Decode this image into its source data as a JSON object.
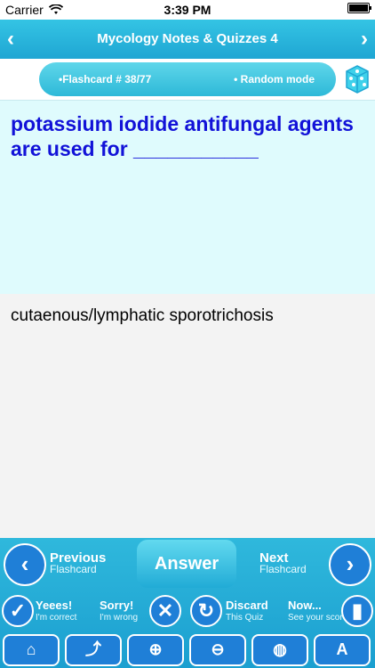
{
  "status": {
    "carrier": "Carrier",
    "time": "3:39 PM"
  },
  "header": {
    "title": "Mycology Notes & Quizzes 4",
    "prev_icon": "chevron-left-icon",
    "next_icon": "chevron-right-icon"
  },
  "info": {
    "flashcard_label": "•Flashcard #  38/77",
    "mode_label": "• Random mode",
    "dice_icon": "dice-icon"
  },
  "question": {
    "text": "potassium iodide antifungal agents are used for ___________"
  },
  "answer": {
    "text": "cutaenous/lymphatic sporotrichosis"
  },
  "controls": {
    "previous_big": "Previous",
    "previous_small": "Flashcard",
    "answer": "Answer",
    "next_big": "Next",
    "next_small": "Flashcard"
  },
  "feedback": [
    {
      "title": "Yeees!",
      "subtitle": "I'm correct",
      "icon": "check-icon"
    },
    {
      "title": "Sorry!",
      "subtitle": "I'm wrong",
      "icon": "x-icon"
    },
    {
      "title": "Discard",
      "subtitle": "This Quiz",
      "icon": "recycle-icon"
    },
    {
      "title": "Now...",
      "subtitle": "See your score",
      "icon": "chart-icon"
    }
  ],
  "tools": [
    {
      "icon": "home-icon"
    },
    {
      "icon": "share-icon"
    },
    {
      "icon": "zoom-in-icon"
    },
    {
      "icon": "zoom-out-icon"
    },
    {
      "icon": "paint-bucket-icon"
    },
    {
      "icon": "font-icon"
    }
  ],
  "colors": {
    "accent": "#1fa6d3",
    "question_text": "#1212d8",
    "question_bg": "#dffbfd"
  }
}
